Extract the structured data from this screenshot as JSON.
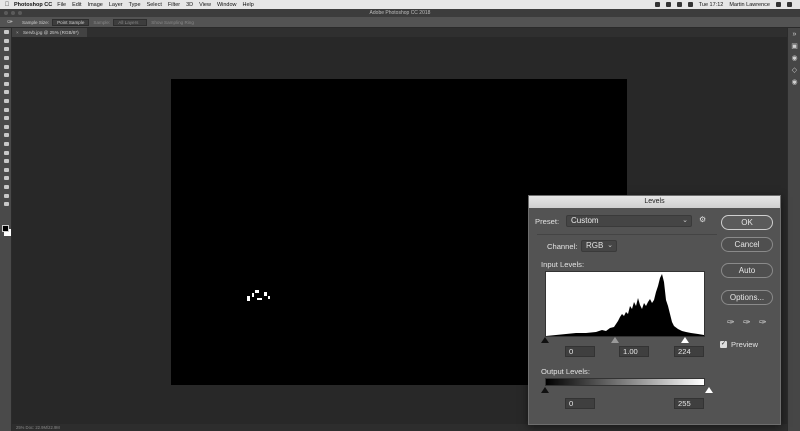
{
  "menubar": {
    "app_name": "Photoshop CC",
    "items": [
      "File",
      "Edit",
      "Image",
      "Layer",
      "Type",
      "Select",
      "Filter",
      "3D",
      "View",
      "Window",
      "Help"
    ],
    "time": "Tue 17:12",
    "user": "Martin Lawrence"
  },
  "window": {
    "title": "Adobe Photoshop CC 2018"
  },
  "options_bar": {
    "tool_icon": "eyedropper-icon",
    "sample_size_label": "Sample Size:",
    "sample_size_value": "Point Sample",
    "sample_label": "Sample:",
    "sample_value": "All Layers",
    "show_ring_label": "Show Sampling Ring"
  },
  "document": {
    "tab_title": "Servb.jpg @ 25% (RGB/8*)"
  },
  "status_bar": {
    "text": "25%     Doc: 22.9M/22.9M"
  },
  "levels_dialog": {
    "title": "Levels",
    "preset_label": "Preset:",
    "preset_value": "Custom",
    "channel_label": "Channel:",
    "channel_value": "RGB",
    "input_levels_label": "Input Levels:",
    "input_black": "0",
    "input_gamma": "1.00",
    "input_white": "224",
    "output_levels_label": "Output Levels:",
    "output_black": "0",
    "output_white": "255",
    "ok_label": "OK",
    "cancel_label": "Cancel",
    "auto_label": "Auto",
    "options_label": "Options...",
    "preview_label": "Preview",
    "preview_checked": true
  },
  "colors": {
    "canvas": "#000000",
    "workspace": "#282828",
    "dialog_bg": "#535353"
  }
}
